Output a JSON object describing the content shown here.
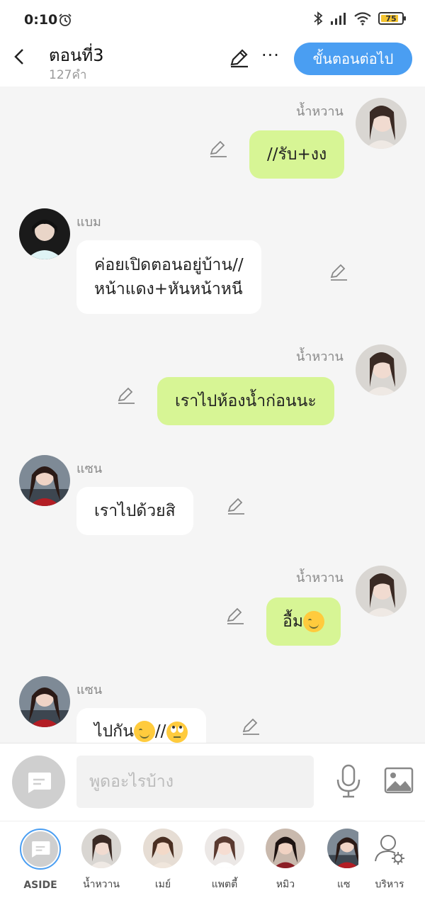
{
  "status": {
    "time": "0:10",
    "battery": "75"
  },
  "header": {
    "title": "ตอนที่3",
    "word_count": "127คำ",
    "next_label": "ขั้นตอนต่อไป"
  },
  "messages": [
    {
      "speaker": "น้ำหวาน",
      "text": "//รับ+งง"
    },
    {
      "speaker": "แบม",
      "line1": "ค่อยเปิดตอนอยู่บ้าน//",
      "line2": "หน้าแดง+หันหน้าหนี"
    },
    {
      "speaker": "น้ำหวาน",
      "text": "เราไปห้องน้ำก่อนนะ"
    },
    {
      "speaker": "แซน",
      "text": "เราไปด้วยสิ"
    },
    {
      "speaker": "น้ำหวาน",
      "text": "อื้ม"
    },
    {
      "speaker": "แซน",
      "text_a": "ไปกัน",
      "text_b": "//"
    }
  ],
  "input": {
    "placeholder": "พูดอะไรบ้าง"
  },
  "characters": [
    {
      "label": "ASIDE"
    },
    {
      "label": "น้ำหวาน"
    },
    {
      "label": "เมย์"
    },
    {
      "label": "แพตตี้"
    },
    {
      "label": "หมิว"
    },
    {
      "label": "แซ"
    },
    {
      "label": "บริหาร"
    }
  ],
  "colors": {
    "accent": "#4a9ef2",
    "my_bubble": "#d7f595",
    "other_bubble": "#ffffff"
  },
  "icons": [
    "alarm-icon",
    "bluetooth-icon",
    "signal-icon",
    "wifi-icon",
    "battery-icon",
    "back-icon",
    "edit-icon",
    "more-icon",
    "pencil-icon",
    "chat-bubble-icon",
    "mic-icon",
    "image-icon",
    "manage-user-icon",
    "smile-emoji",
    "eye-roll-emoji"
  ]
}
